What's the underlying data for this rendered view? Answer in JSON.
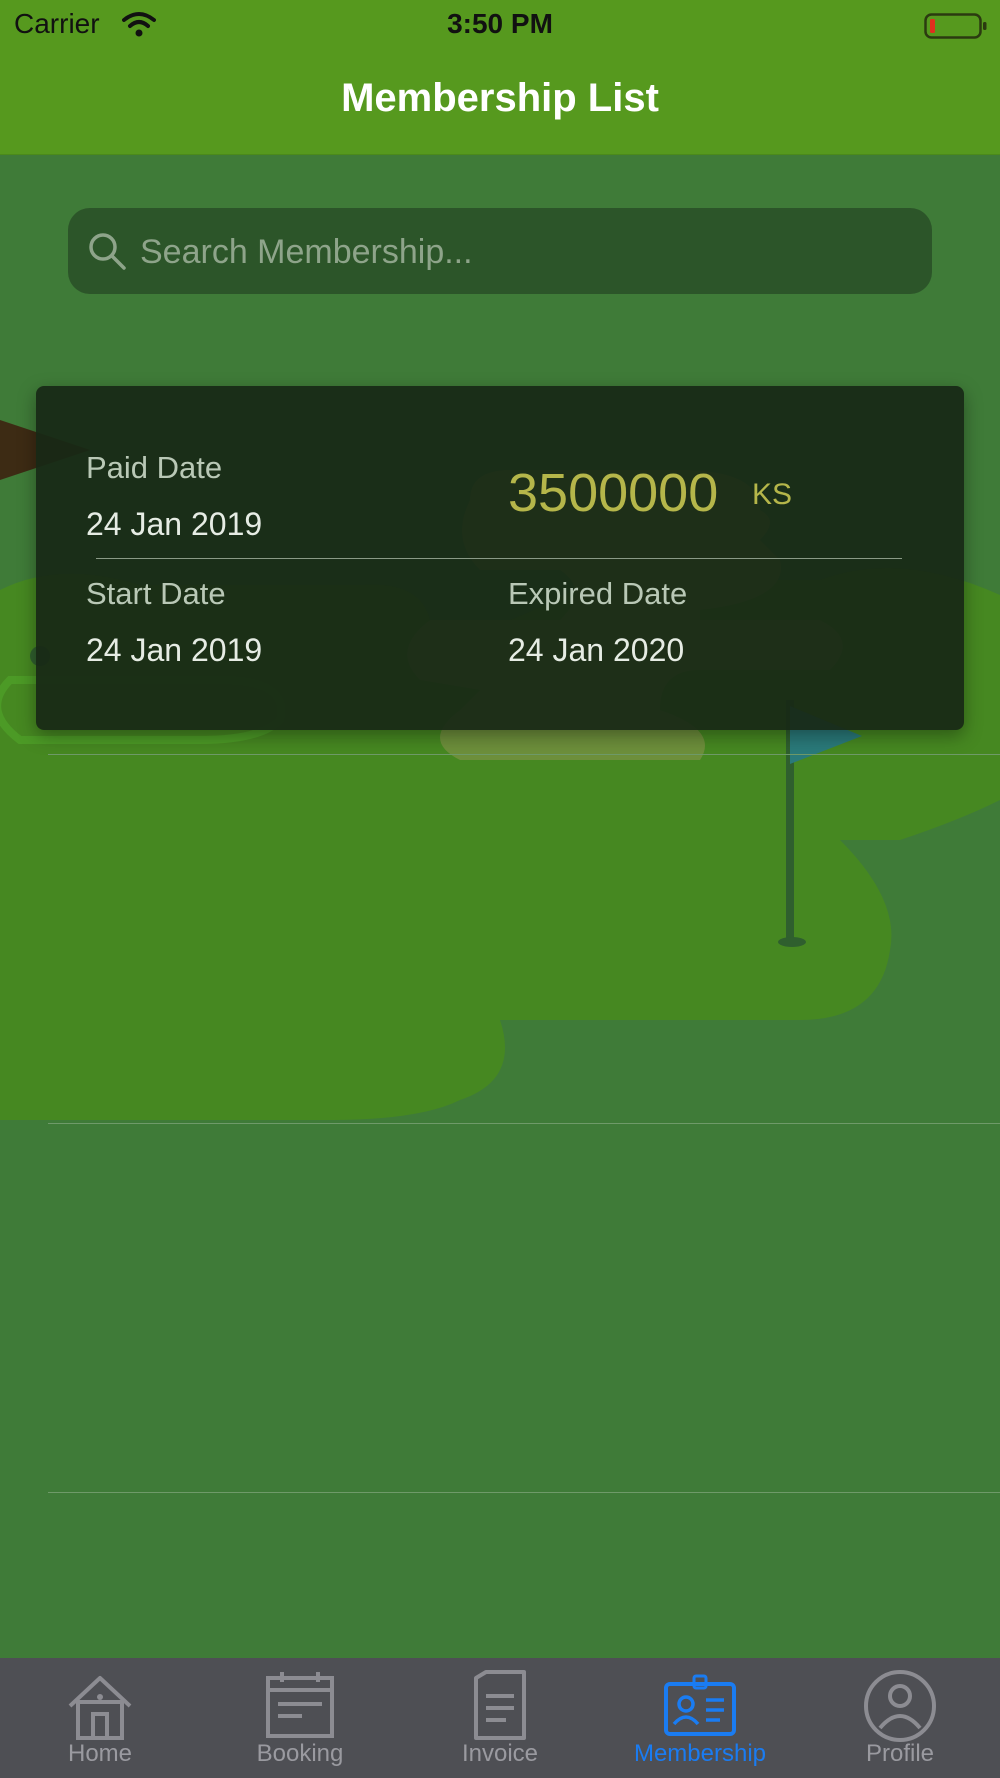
{
  "status_bar": {
    "carrier": "Carrier",
    "time": "3:50 PM"
  },
  "nav": {
    "title": "Membership List"
  },
  "search": {
    "placeholder": "Search Membership...",
    "value": ""
  },
  "membership_card": {
    "paid_date_label": "Paid Date",
    "paid_date": "24 Jan 2019",
    "amount": "3500000",
    "currency": "KS",
    "start_date_label": "Start Date",
    "start_date": "24 Jan 2019",
    "expired_date_label": "Expired Date",
    "expired_date": "24 Jan 2020"
  },
  "tabs": [
    {
      "label": "Home",
      "icon": "home-icon",
      "active": false
    },
    {
      "label": "Booking",
      "icon": "calendar-icon",
      "active": false
    },
    {
      "label": "Invoice",
      "icon": "document-icon",
      "active": false
    },
    {
      "label": "Membership",
      "icon": "id-card-icon",
      "active": true
    },
    {
      "label": "Profile",
      "icon": "user-icon",
      "active": false
    }
  ],
  "colors": {
    "header": "#56991e",
    "background": "#3f7b38",
    "accent": "#1a7cf2",
    "amount": "#b5b64a",
    "tab_bar": "#4e4f54"
  }
}
